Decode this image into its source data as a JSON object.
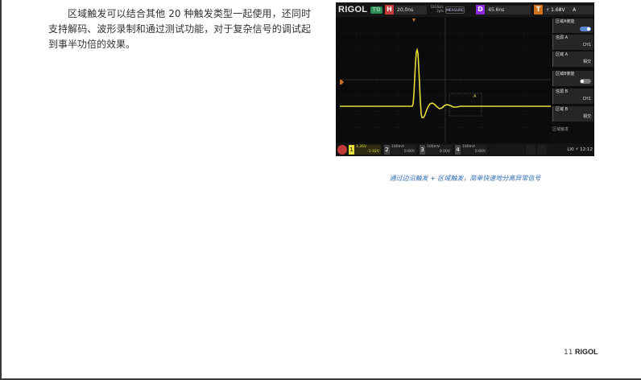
{
  "body_text": "区域触发可以结合其他 20 种触发类型一起使用，还同时支持解码、波形录制和通过测试功能，对于复杂信号的调试起到事半功倍的效果。",
  "screenshot": {
    "logo": "RIGOL",
    "trigger_status": "T'D",
    "timebase_label": "H",
    "timebase": "20.0ns",
    "sample_rate_top": "10GSa/s",
    "sample_rate_bottom": "2pts",
    "measure_button": "MEASURE",
    "stop_run_button": "STOP/RUN",
    "delay_label": "D",
    "delay": "45.6ns",
    "trigger_label": "T",
    "trigger_level": "1.68V",
    "trigger_source": "A",
    "zone_label": "A",
    "panel": {
      "zone_a_enable": "区域A使能",
      "side_label": "区域触发",
      "source_a_label": "信源 A",
      "source_a_value": "CH1",
      "zone_a_label": "区域 A",
      "zone_a_value": "相交",
      "zone_b_enable": "区域B使能",
      "source_b_label": "信源 B",
      "source_b_value": "CH1",
      "zone_b_label": "区域 B",
      "zone_b_value": "相交"
    },
    "channels": [
      {
        "num": "1",
        "scale": "1.26V",
        "offset": "-1.92V"
      },
      {
        "num": "2",
        "scale": "100mV",
        "offset": "0.00V"
      },
      {
        "num": "3",
        "scale": "100mV",
        "offset": "0.00V"
      },
      {
        "num": "4",
        "scale": "100mV",
        "offset": "0.00V"
      }
    ],
    "time": "12:12",
    "colors": {
      "ch1": "#e6dc3a",
      "trigger": "#d0731f",
      "accent": "#2f6fb5"
    }
  },
  "caption": "通过边沿触发 + 区域触发，简单快速地分离异常信号",
  "footer": {
    "page_number": "11",
    "brand": "RIGOL"
  }
}
